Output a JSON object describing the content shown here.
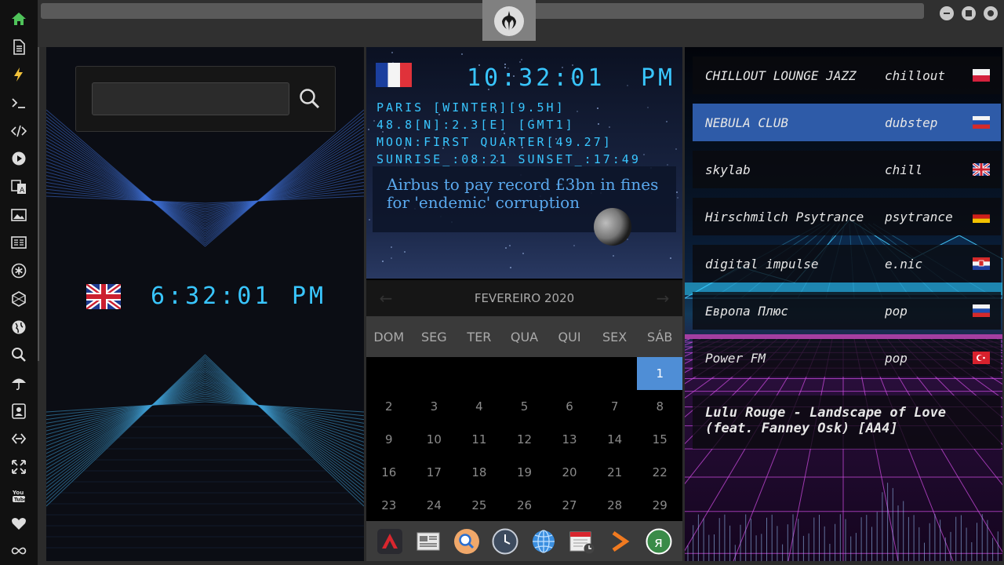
{
  "topbar": {
    "buttons": [
      "minimize",
      "maximize",
      "close"
    ]
  },
  "sidebar": {
    "items": [
      {
        "icon": "home-icon",
        "active": true
      },
      {
        "icon": "document-icon"
      },
      {
        "icon": "lightning-icon"
      },
      {
        "icon": "terminal-icon"
      },
      {
        "icon": "code-icon"
      },
      {
        "icon": "play-icon"
      },
      {
        "icon": "translate-icon"
      },
      {
        "icon": "image-icon"
      },
      {
        "icon": "news-icon"
      },
      {
        "icon": "asterisk-icon"
      },
      {
        "icon": "hexagon-icon"
      },
      {
        "icon": "globe-icon"
      },
      {
        "icon": "search-icon"
      },
      {
        "icon": "umbrella-icon"
      },
      {
        "icon": "contact-icon"
      },
      {
        "icon": "link-icon"
      },
      {
        "icon": "expand-icon"
      },
      {
        "icon": "youtube-icon"
      },
      {
        "icon": "heart-icon"
      },
      {
        "icon": "infinity-icon"
      }
    ]
  },
  "left": {
    "search": {
      "value": "",
      "placeholder": ""
    },
    "clock": {
      "time": "6:32:01",
      "ampm": "PM",
      "flag": "uk"
    }
  },
  "center": {
    "clock": {
      "time": "10:32:01",
      "ampm": "PM",
      "flag": "france"
    },
    "info": [
      "PARIS [WINTER][9.5H]",
      "48.8[N]:2.3[E] [GMT1]",
      "MOON:FIRST QUARTER[49.27]",
      "SUNRISE_:08:21 SUNSET_:17:49"
    ],
    "news": "Airbus to pay record £3bn in fines for 'endemic' corruption",
    "calendar": {
      "month": "FEVEREIRO 2020",
      "weekdays": [
        "DOM",
        "SEG",
        "TER",
        "QUA",
        "QUI",
        "SEX",
        "SÁB"
      ],
      "days": [
        "",
        "",
        "",
        "",
        "",
        "",
        "1",
        "2",
        "3",
        "4",
        "5",
        "6",
        "7",
        "8",
        "9",
        "10",
        "11",
        "12",
        "13",
        "14",
        "15",
        "16",
        "17",
        "18",
        "19",
        "20",
        "21",
        "22",
        "23",
        "24",
        "25",
        "26",
        "27",
        "28",
        "29"
      ],
      "selected": "1"
    },
    "dock": [
      "app-a-icon",
      "newspaper-icon",
      "magnifier-icon",
      "clock-icon",
      "globe-icon",
      "calendar-icon",
      "arrow-icon",
      "yandex-icon"
    ]
  },
  "right": {
    "stations": [
      {
        "name": "CHILLOUT LOUNGE JAZZ",
        "genre": "chillout",
        "flag": "poland"
      },
      {
        "name": "NEBULA CLUB",
        "genre": "dubstep",
        "flag": "russia",
        "active": true
      },
      {
        "name": "skylab",
        "genre": "chill",
        "flag": "uk"
      },
      {
        "name": "Hirschmilch Psytrance",
        "genre": "psytrance",
        "flag": "germany"
      },
      {
        "name": "digital impulse",
        "genre": "e.nic",
        "flag": "croatia"
      },
      {
        "name": "Европа Плюс",
        "genre": "pop",
        "flag": "russia"
      },
      {
        "name": "Power FM",
        "genre": "pop",
        "flag": "turkey"
      }
    ],
    "now_playing": "Lulu Rouge - Landscape of Love (feat. Fanney Osk) [AA4]"
  }
}
